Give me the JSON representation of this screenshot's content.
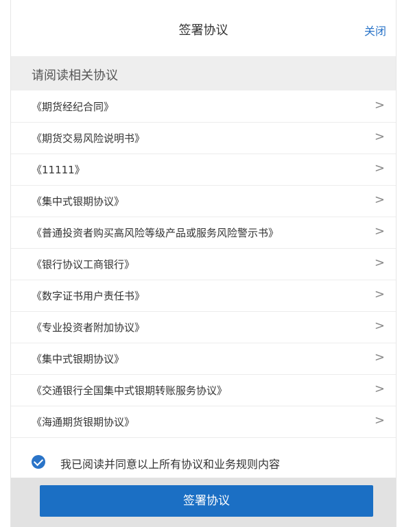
{
  "header": {
    "title": "签署协议",
    "close_label": "关闭"
  },
  "section": {
    "title": "请阅读相关协议"
  },
  "agreements": [
    {
      "label": "《期货经纪合同》"
    },
    {
      "label": "《期货交易风险说明书》"
    },
    {
      "label": "《11111》"
    },
    {
      "label": "《集中式银期协议》"
    },
    {
      "label": "《普通投资者购买高风险等级产品或服务风险警示书》"
    },
    {
      "label": "《银行协议工商银行》"
    },
    {
      "label": "《数字证书用户责任书》"
    },
    {
      "label": "《专业投资者附加协议》"
    },
    {
      "label": "《集中式银期协议》"
    },
    {
      "label": "《交通银行全国集中式银期转账服务协议》"
    },
    {
      "label": "《海通期货银期协议》"
    }
  ],
  "chevron": ">",
  "agree": {
    "text": "我已阅读并同意以上所有协议和业务规则内容",
    "checked": true
  },
  "footer": {
    "sign_label": "签署协议"
  },
  "colors": {
    "accent": "#1b6fc4",
    "link": "#2a74c8"
  }
}
